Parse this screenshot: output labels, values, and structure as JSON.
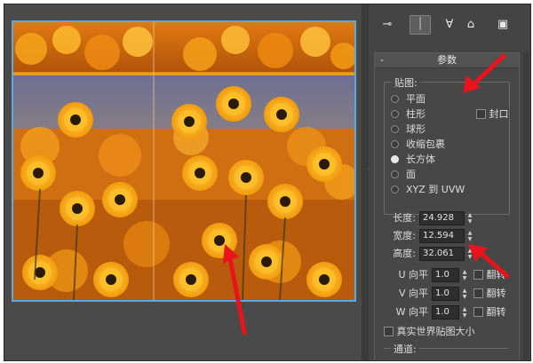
{
  "toolbar": {
    "icons": [
      "pin-stack-icon",
      "show-end-result-icon",
      "make-unique-icon",
      "remove-modifier-icon",
      "configure-sets-icon"
    ]
  },
  "rollout": {
    "collapse": "-",
    "title": "参数"
  },
  "mapping": {
    "group_label": "贴图:",
    "options": [
      "平面",
      "柱形",
      "球形",
      "收缩包裹",
      "长方体",
      "面",
      "XYZ 到 UVW"
    ],
    "selected": "长方体",
    "cap_label": "封口"
  },
  "dimensions": {
    "length_label": "长度:",
    "length_value": "24.928",
    "width_label": "宽度:",
    "width_value": "12.594",
    "height_label": "高度:",
    "height_value": "32.061"
  },
  "tiling": {
    "u_label": "U 向平",
    "u_value": "1.0",
    "v_label": "V 向平",
    "v_value": "1.0",
    "w_label": "W 向平",
    "w_value": "1.0",
    "flip_label": "翻转"
  },
  "real_world": {
    "label": "真实世界贴图大小"
  },
  "channel": {
    "label": "通道:"
  },
  "colors": {
    "accent_arrow": "#e8141c",
    "viewport_bg": "#4a4a4a",
    "selection_border": "#5aa9e6"
  }
}
